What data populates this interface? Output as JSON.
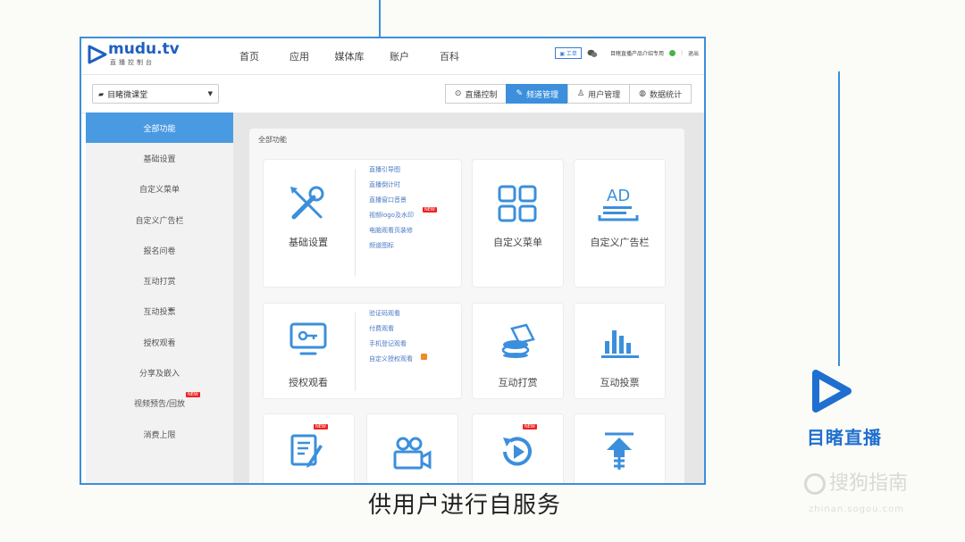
{
  "app": {
    "logo_brand": "mudu.tv",
    "logo_sub": "直播控制台"
  },
  "nav": [
    "首页",
    "应用",
    "媒体库",
    "账户",
    "百科"
  ],
  "topright": {
    "ticket": "工单",
    "account": "目睹直播产品介绍专用",
    "logout": "退出"
  },
  "room_select": {
    "value": "目睹微课堂"
  },
  "tabs": [
    {
      "label": "直播控制",
      "active": false
    },
    {
      "label": "频道管理",
      "active": true
    },
    {
      "label": "用户管理",
      "active": false
    },
    {
      "label": "数据统计",
      "active": false
    }
  ],
  "sidebar": [
    {
      "label": "全部功能",
      "active": true
    },
    {
      "label": "基础设置"
    },
    {
      "label": "自定义菜单"
    },
    {
      "label": "自定义广告栏"
    },
    {
      "label": "报名问卷"
    },
    {
      "label": "互动打赏"
    },
    {
      "label": "互动投票"
    },
    {
      "label": "授权观看"
    },
    {
      "label": "分享及嵌入"
    },
    {
      "label": "视频预告/回放",
      "badge": "NEW"
    },
    {
      "label": "消费上限"
    }
  ],
  "panel": {
    "title": "全部功能"
  },
  "cards": {
    "basic": {
      "label": "基础设置",
      "links": [
        "直播引导图",
        "直播倒计时",
        "直播窗口音景",
        "视频logo及水印",
        "电脑观看页装修",
        "频道图标"
      ],
      "link_badge": "NEW"
    },
    "menu": {
      "label": "自定义菜单"
    },
    "ad": {
      "label": "自定义广告栏",
      "icon_text": "AD"
    },
    "auth": {
      "label": "授权观看",
      "links": [
        "验证码观看",
        "付费观看",
        "手机登记观看",
        "自定义授权观看"
      ]
    },
    "reward": {
      "label": "互动打赏"
    },
    "vote": {
      "label": "互动投票"
    },
    "row3_badges": [
      "NEW",
      "NEW"
    ]
  },
  "caption": "供用户进行自服务",
  "side_brand": "目睹直播",
  "watermark": {
    "text": "搜狗指南",
    "url": "zhinan.sogou.com"
  },
  "colors": {
    "accent": "#3b8fdc",
    "link": "#4a78c2",
    "badge": "#e22222"
  }
}
